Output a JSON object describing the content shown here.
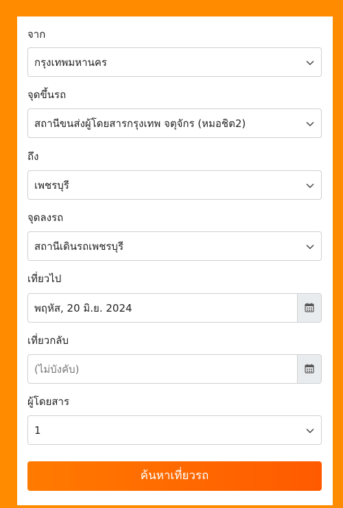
{
  "form": {
    "origin": {
      "label": "จาก",
      "value": "กรุงเทพมหานคร"
    },
    "boarding_point": {
      "label": "จุดขึ้นรถ",
      "value": "สถานีขนส่งผู้โดยสารกรุงเทพ จตุจักร (หมอชิต2)"
    },
    "destination": {
      "label": "ถึง",
      "value": "เพชรบุรี"
    },
    "dropoff_point": {
      "label": "จุดลงรถ",
      "value": "สถานีเดินรถเพชรบุรี"
    },
    "departure": {
      "label": "เที่ยวไป",
      "value": "พฤหัส, 20 มิ.ย. 2024"
    },
    "return": {
      "label": "เที่ยวกลับ",
      "placeholder": "(ไม่บังคับ)"
    },
    "passengers": {
      "label": "ผู้โดยสาร",
      "value": "1"
    },
    "search_button": "ค้นหาเที่ยวรถ"
  },
  "colors": {
    "background": "#ff8c00",
    "button": "#ff6a00"
  },
  "icons": {
    "dropdown": "chevron-down-icon",
    "date": "calendar-icon"
  }
}
